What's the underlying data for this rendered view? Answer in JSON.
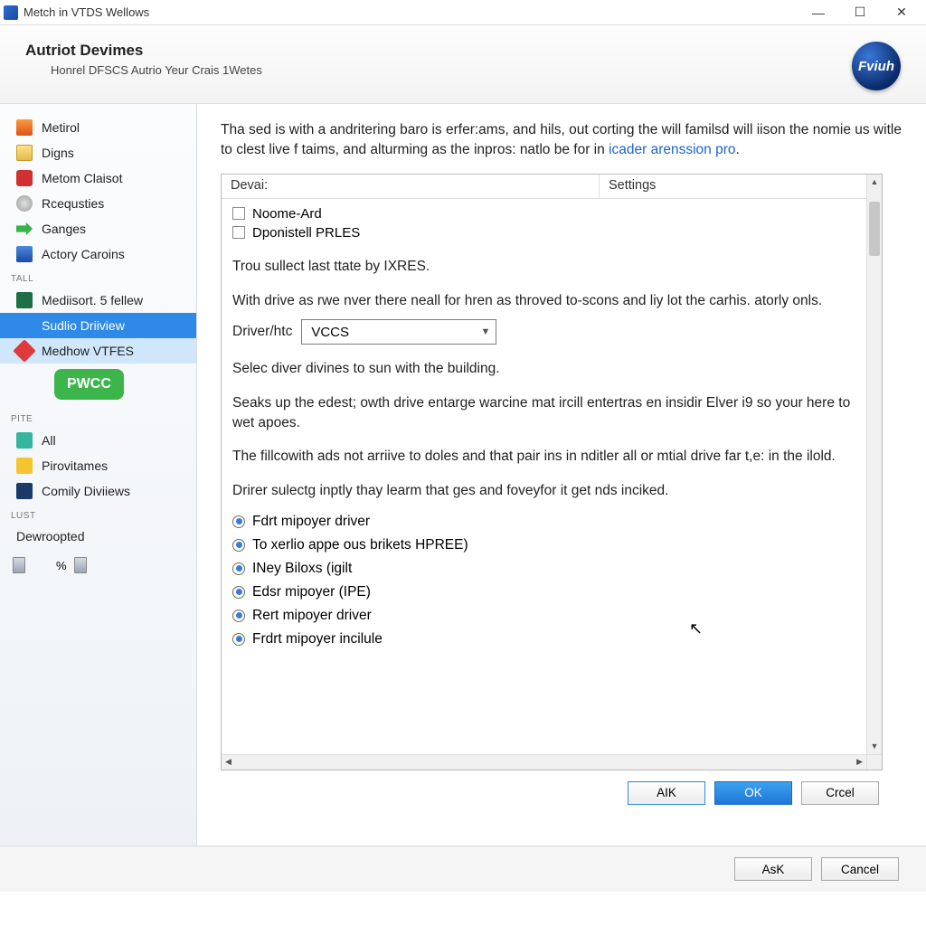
{
  "titlebar": {
    "text": "Metch in VTDS Wellows"
  },
  "header": {
    "title": "Autriot Devimes",
    "subtitle": "Honrel DFSCS Autrio Yeur Crais 1Wetes",
    "logo_text": "Fviuh"
  },
  "sidebar": {
    "items": [
      {
        "label": "Metirol"
      },
      {
        "label": "Digns"
      },
      {
        "label": "Metom Claisot"
      },
      {
        "label": "Rcequsties"
      },
      {
        "label": "Ganges"
      },
      {
        "label": "Actory Caroins"
      }
    ],
    "group_tall": "TALL",
    "tall_items": [
      {
        "label": "Mediisort. 5 fellew"
      },
      {
        "label": "Sudlio Driiview",
        "selected": true
      },
      {
        "label": "Medhow VTFES",
        "highlight": true
      }
    ],
    "badge": "PWCC",
    "group_pite": "PITE",
    "pite_items": [
      {
        "label": "All"
      },
      {
        "label": "Pirovitames"
      },
      {
        "label": "Comily Diviiews"
      }
    ],
    "group_lust": "LUST",
    "lust_items": [
      {
        "label": "Dewroopted"
      }
    ],
    "slider_value": "%"
  },
  "main": {
    "description_pre": "Tha sed is with a andritering baro is erfer:ams, and hils, out corting the will familsd will iison the nomie us witle to clest live f taims, and alturming as the inpros: natlo be for in ",
    "description_link": "icader arenssion pro",
    "description_post": ".",
    "columns": {
      "c1": "Devai:",
      "c2": "Settings"
    },
    "checkboxes": [
      {
        "label": "Noome-Ard"
      },
      {
        "label": "Dponistell PRLES"
      }
    ],
    "para1": "Trou sullect last ttate by IXRES.",
    "para2": "With drive as rwe nver there neall for hren as throved to-scons and liy lot the carhis. atorly onls.",
    "driver_label": "Driver/htc",
    "driver_value": "VCCS",
    "para3": "Selec diver divines to sun with the building.",
    "para4": "Seaks up the edest; owth drive entarge warcine mat ircill entertras en insidir Elver i9 so your here to wet apoes.",
    "para5": "The fillcowith ads not arriive to doles and that pair ins in nditler all or mtial drive far t,e: in the ilold.",
    "para6": "Drirer sulectg inptly thay learm that ges and foveyfor it get nds inciked.",
    "radios": [
      {
        "label": "Fdrt mipoyer driver"
      },
      {
        "label": "To xerlio appe ous brikets HPREE)"
      },
      {
        "label": "INey Biloxs (igilt"
      },
      {
        "label": "Edsr mipoyer (IPE)"
      },
      {
        "label": "Rert mipoyer driver"
      },
      {
        "label": "Frdrt mipoyer incilule"
      }
    ]
  },
  "buttons": {
    "inner_aik": "AIK",
    "inner_ok": "OK",
    "inner_cancel": "Crcel",
    "outer_ask": "AsK",
    "outer_cancel": "Cancel"
  }
}
